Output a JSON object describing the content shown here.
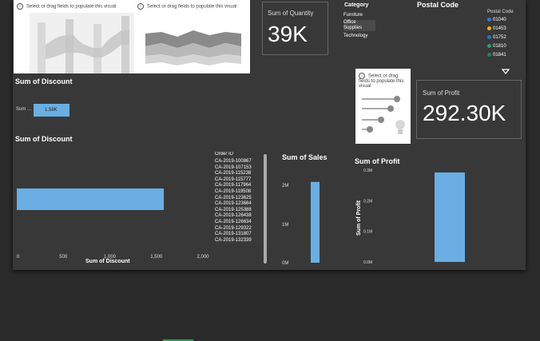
{
  "placeholder": {
    "text_left": "Select or drag fields to populate this visual",
    "text_mid": "Select or drag fields to populate this visual",
    "text_small": "Select or drag fields to populate this visual"
  },
  "cards": {
    "quantity_label": "Sum of Quantity",
    "quantity_value": "39K",
    "profit_label": "Sum of Profit",
    "profit_value": "292.30K"
  },
  "category_slicer": {
    "title": "Category",
    "items": [
      "Furniture",
      "Office Supplies",
      "Technology"
    ]
  },
  "postal": {
    "title": "Postal Code",
    "legend_title": "Postal Code",
    "items": [
      {
        "code": "01040",
        "color": "#3a78c9"
      },
      {
        "code": "01453",
        "color": "#e5b024"
      },
      {
        "code": "01752",
        "color": "#3a6fb0"
      },
      {
        "code": "01810",
        "color": "#2e9a7a"
      },
      {
        "code": "01841",
        "color": "#2e7a6a"
      }
    ]
  },
  "discount_top": {
    "title": "Sum of Discount",
    "category_label": "Sum ...",
    "bar_label": "1.58K"
  },
  "discount_chart": {
    "title": "Sum of Discount",
    "xlabel": "Sum of Discount",
    "ticks": [
      "0",
      "500",
      "1,000",
      "1,500",
      "2,000"
    ]
  },
  "orders": {
    "header": "Order ID",
    "ids": [
      "CA-2019-100867",
      "CA-2019-107153",
      "CA-2019-115238",
      "CA-2019-115777",
      "CA-2019-117964",
      "CA-2019-119508",
      "CA-2019-123625",
      "CA-2019-123664",
      "CA-2019-125388",
      "CA-2019-126438",
      "CA-2019-126634",
      "CA-2019-129322",
      "CA-2019-131807",
      "CA-2019-132339"
    ]
  },
  "sales": {
    "title": "Sum of Sales",
    "ticks": [
      "2M",
      "1M",
      "0M"
    ]
  },
  "profit_chart": {
    "title": "Sum of Profit",
    "ylabel": "Sum of Profit",
    "ticks": [
      "0.3M",
      "0.2M",
      "0.1M",
      "0.0M"
    ]
  },
  "chart_data": [
    {
      "type": "bar",
      "title": "Sum of Discount",
      "categories": [
        "Sum of Discount"
      ],
      "values": [
        1580
      ],
      "xlim": [
        0,
        2000
      ],
      "orientation": "horizontal"
    },
    {
      "type": "bar",
      "title": "Sum of Sales",
      "categories": [
        ""
      ],
      "values": [
        2300000
      ],
      "ylim": [
        0,
        2500000
      ]
    },
    {
      "type": "bar",
      "title": "Sum of Profit",
      "categories": [
        ""
      ],
      "values": [
        292300
      ],
      "ylabel": "Sum of Profit",
      "ylim": [
        0,
        300000
      ]
    }
  ],
  "colors": {
    "bar": "#6aaee3",
    "background": "#383838",
    "outer": "#2b2b2b"
  }
}
